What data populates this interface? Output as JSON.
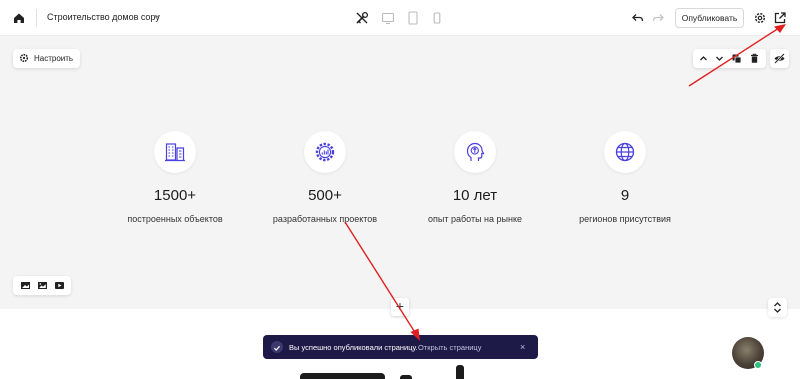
{
  "header": {
    "site_title": "Строительство домов copy",
    "publish_label": "Опубликовать",
    "icons": [
      "home-icon",
      "chevron-down-icon",
      "design-tools-icon",
      "desktop-icon",
      "tablet-icon",
      "mobile-icon",
      "undo-icon",
      "redo-icon",
      "gear-icon",
      "external-link-icon"
    ]
  },
  "canvas": {
    "customize_label": "Настроить",
    "block_controls": [
      "move-up-icon",
      "move-down-icon",
      "duplicate-icon",
      "delete-icon",
      "hide-icon"
    ],
    "media_controls": [
      "image-icon",
      "gallery-icon",
      "video-icon"
    ],
    "stats": [
      {
        "number": "1500+",
        "label": "построенных объектов",
        "icon": "buildings-icon"
      },
      {
        "number": "500+",
        "label": "разработанных проектов",
        "icon": "gear-chart-icon"
      },
      {
        "number": "10 лет",
        "label": "опыт работы на рынке",
        "icon": "head-growth-icon"
      },
      {
        "number": "9",
        "label": "регионов присутствия",
        "icon": "globe-icon"
      }
    ],
    "add_block_label": "+"
  },
  "toast": {
    "message": "Вы успешно опубликовали страницу.",
    "link": "Открыть страницу",
    "close": "×"
  },
  "colors": {
    "accent": "#4a40e0",
    "toast_bg": "#1d1a48",
    "canvas_bg": "#f4f4f4",
    "annotation_arrow": "#e02020",
    "online": "#2ec27e"
  }
}
